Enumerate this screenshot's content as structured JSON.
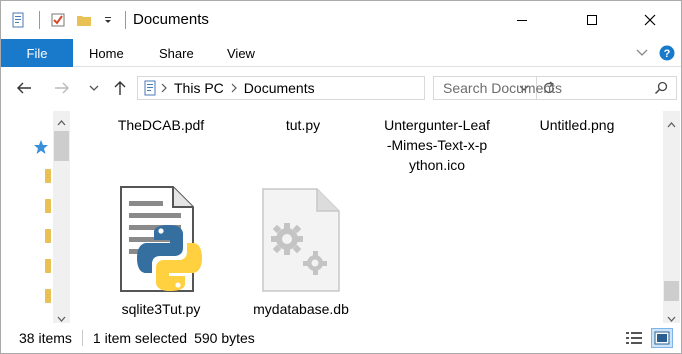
{
  "window": {
    "title": "Documents"
  },
  "ribbon": {
    "file_label": "File",
    "tabs": [
      "Home",
      "Share",
      "View"
    ]
  },
  "address": {
    "crumbs": [
      "This PC",
      "Documents"
    ]
  },
  "search": {
    "placeholder": "Search Documents"
  },
  "files": [
    {
      "name_lines": [
        "TheDCAB.pdf"
      ],
      "icon": "none-visible"
    },
    {
      "name_lines": [
        "tut.py"
      ],
      "icon": "none-visible"
    },
    {
      "name_lines": [
        "Untergunter-Leaf",
        "-Mimes-Text-x-p",
        "ython.ico"
      ],
      "icon": "none-visible"
    },
    {
      "name_lines": [
        "Untitled.png"
      ],
      "icon": "none-visible"
    },
    {
      "name_lines": [
        "sqlite3Tut.py"
      ],
      "icon": "python-file-icon"
    },
    {
      "name_lines": [
        "mydatabase.db"
      ],
      "icon": "settings-file-icon"
    }
  ],
  "status": {
    "item_count": "38 items",
    "selection": "1 item selected",
    "size": "590 bytes"
  },
  "colors": {
    "file_tab": "#1979ca",
    "folder": "#e8c053",
    "quick_access_star": "#3a8fd8",
    "python_blue": "#356fa0",
    "python_yellow": "#ffd040"
  }
}
